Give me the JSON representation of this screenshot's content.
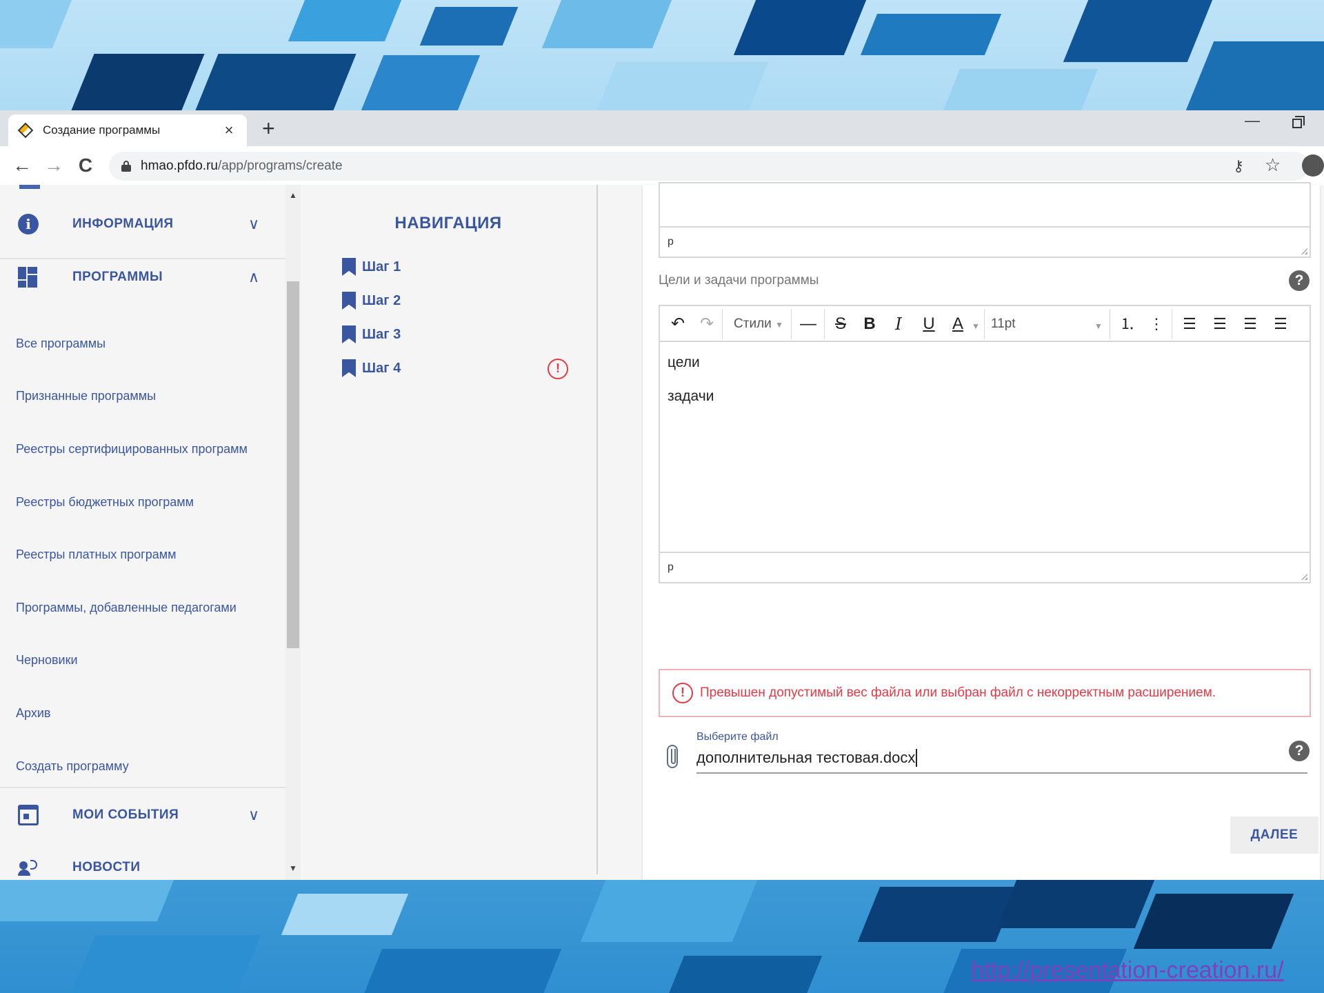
{
  "browser": {
    "tab_title": "Создание программы",
    "tab_close": "×",
    "new_tab": "+",
    "minimize": "—",
    "back": "←",
    "forward": "→",
    "reload": "C",
    "url_host": "hmao.pfdo.ru",
    "url_path": "/app/programs/create"
  },
  "sidebar": {
    "sections": [
      {
        "label": "ИНФОРМАЦИЯ",
        "icon": "info-icon",
        "chevron": "∨"
      },
      {
        "label": "ПРОГРАММЫ",
        "icon": "dashboard-icon",
        "chevron": "∧"
      },
      {
        "label": "МОИ СОБЫТИЯ",
        "icon": "calendar-icon",
        "chevron": "∨"
      },
      {
        "label": "НОВОСТИ",
        "icon": "announcement-icon"
      }
    ],
    "program_items": [
      "Все программы",
      "Признанные программы",
      "Реестры сертифицированных программ",
      "Реестры бюджетных программ",
      "Реестры платных программ",
      "Программы, добавленные педагогами",
      "Черновики",
      "Архив",
      "Создать программу"
    ]
  },
  "navigation": {
    "title": "НАВИГАЦИЯ",
    "steps": [
      "Шаг 1",
      "Шаг 2",
      "Шаг 3",
      "Шаг 4"
    ],
    "error_mark": "!"
  },
  "form": {
    "prev_editor_status": "p",
    "goals_label": "Цели и задачи программы",
    "help": "?",
    "toolbar": {
      "styles": "Стили",
      "font_size": "11pt"
    },
    "goals_lines": [
      "цели",
      "задачи"
    ],
    "goals_status": "p",
    "error_message": "Превышен допустимый вес файла или выбран файл с некорректным расширением.",
    "file_label": "Выберите файл",
    "file_value": "дополнительная тестовая.docx",
    "next_label": "ДАЛЕЕ"
  },
  "footer": {
    "link": "http://presentation-creation.ru/"
  },
  "colors": {
    "accent": "#3a56a0",
    "error": "#e53945",
    "card_border": "#3f6cb5"
  }
}
